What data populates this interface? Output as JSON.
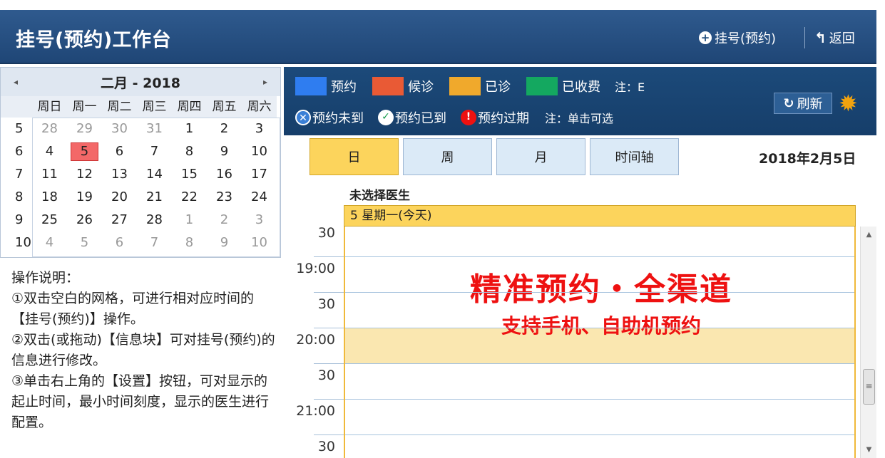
{
  "header": {
    "title": "挂号(预约)工作台",
    "register_label": "挂号(预约)",
    "back_label": "返回"
  },
  "calendar": {
    "month_label": "二月 - 2018",
    "weekdays": [
      "周日",
      "周一",
      "周二",
      "周三",
      "周四",
      "周五",
      "周六"
    ],
    "weeks": [
      {
        "week": "5",
        "days": [
          "28",
          "29",
          "30",
          "31",
          "1",
          "2",
          "3"
        ]
      },
      {
        "week": "6",
        "days": [
          "4",
          "5",
          "6",
          "7",
          "8",
          "9",
          "10"
        ]
      },
      {
        "week": "7",
        "days": [
          "11",
          "12",
          "13",
          "14",
          "15",
          "16",
          "17"
        ]
      },
      {
        "week": "8",
        "days": [
          "18",
          "19",
          "20",
          "21",
          "22",
          "23",
          "24"
        ]
      },
      {
        "week": "9",
        "days": [
          "25",
          "26",
          "27",
          "28",
          "1",
          "2",
          "3"
        ]
      },
      {
        "week": "10",
        "days": [
          "4",
          "5",
          "6",
          "7",
          "8",
          "9",
          "10"
        ]
      }
    ],
    "selected_day": "5"
  },
  "instructions": {
    "title": "操作说明：",
    "line1": "①双击空白的网格，可进行相对应时间的【挂号(预约)】操作。",
    "line2": "②双击(或拖动)【信息块】可对挂号(预约)的信息进行修改。",
    "line3": "③单击右上角的【设置】按钮，可对显示的起止时间，最小时间刻度，显示的医生进行配置。"
  },
  "legend": {
    "items": [
      {
        "label": "预约",
        "color": "#2f7df0"
      },
      {
        "label": "候诊",
        "color": "#e95a35"
      },
      {
        "label": "已诊",
        "color": "#f0a92c"
      },
      {
        "label": "已收费",
        "color": "#14a860"
      }
    ],
    "note1": "注：E",
    "status_items": [
      {
        "label": "预约未到"
      },
      {
        "label": "预约已到"
      },
      {
        "label": "预约过期"
      }
    ],
    "note2": "注：单击可选",
    "refresh_label": "刷新"
  },
  "views": {
    "day": "日",
    "week": "周",
    "month": "月",
    "timeline": "时间轴",
    "current_date": "2018年2月5日"
  },
  "schedule": {
    "doctor_label": "未选择医生",
    "day_header": "5 星期一(今天)",
    "time_labels": [
      "30",
      "19:00",
      "30",
      "20:00",
      "30",
      "21:00",
      "30"
    ]
  },
  "promo": {
    "title": "精准预约・全渠道",
    "subtitle": "支持手机、自助机预约"
  }
}
